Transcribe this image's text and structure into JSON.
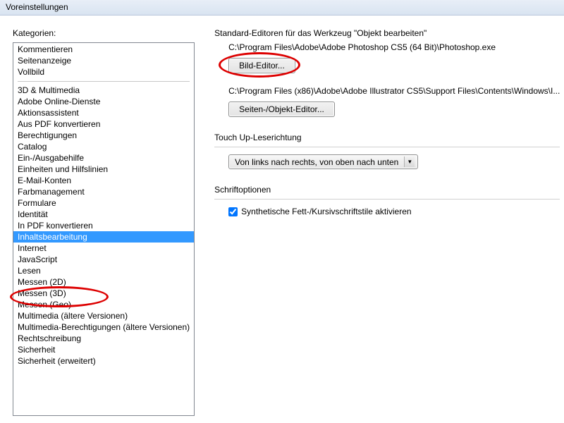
{
  "window": {
    "title": "Voreinstellungen"
  },
  "left": {
    "label": "Kategorien:",
    "items_a": [
      "Kommentieren",
      "Seitenanzeige",
      "Vollbild"
    ],
    "items_b": [
      "3D & Multimedia",
      "Adobe Online-Dienste",
      "Aktionsassistent",
      "Aus PDF konvertieren",
      "Berechtigungen",
      "Catalog",
      "Ein-/Ausgabehilfe",
      "Einheiten und Hilfslinien",
      "E-Mail-Konten",
      "Farbmanagement",
      "Formulare",
      "Identität",
      "In PDF konvertieren",
      "Inhaltsbearbeitung",
      "Internet",
      "JavaScript",
      "Lesen",
      "Messen (2D)",
      "Messen (3D)",
      "Messen (Geo)",
      "Multimedia (ältere Versionen)",
      "Multimedia-Berechtigungen (ältere Versionen)",
      "Rechtschreibung",
      "Sicherheit",
      "Sicherheit (erweitert)"
    ],
    "selected": "Inhaltsbearbeitung"
  },
  "right": {
    "editors_label": "Standard-Editoren für das Werkzeug \"Objekt bearbeiten\"",
    "image_path": "C:\\Program Files\\Adobe\\Adobe Photoshop CS5 (64 Bit)\\Photoshop.exe",
    "image_button": "Bild-Editor...",
    "page_path": "C:\\Program Files (x86)\\Adobe\\Adobe Illustrator CS5\\Support Files\\Contents\\Windows\\I...",
    "page_button": "Seiten-/Objekt-Editor...",
    "touchup_label": "Touch Up-Leserichtung",
    "touchup_value": "Von links nach rechts, von oben nach unten",
    "font_label": "Schriftoptionen",
    "font_checkbox": "Synthetische Fett-/Kursivschriftstile aktivieren",
    "font_checked": true
  }
}
